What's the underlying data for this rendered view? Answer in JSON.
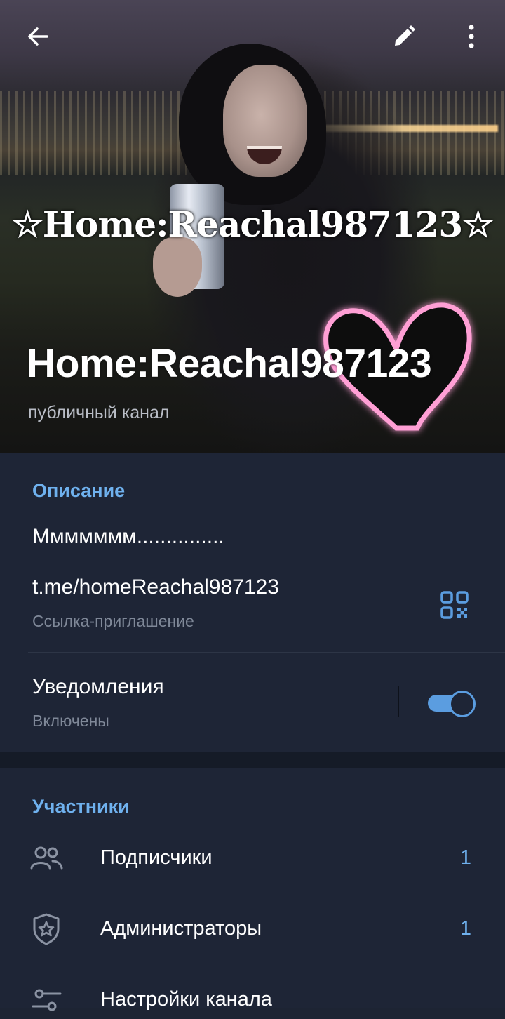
{
  "header": {
    "watermark_text": "☆Home:Reachal987123☆",
    "title": "Home:Reachal987123",
    "subtitle": "публичный канал",
    "icons": {
      "back": "arrow-back-icon",
      "edit": "pencil-icon",
      "menu": "more-vertical-icon"
    }
  },
  "info": {
    "section_title": "Описание",
    "description": "Ммммммм...............",
    "link": "t.me/homeReachal987123",
    "link_caption": "Ссылка-приглашение",
    "qr_icon": "qr-code-icon",
    "notifications_label": "Уведомления",
    "notifications_status": "Включены",
    "notifications_on": true
  },
  "members": {
    "section_title": "Участники",
    "rows": [
      {
        "icon": "users-icon",
        "label": "Подписчики",
        "count": "1"
      },
      {
        "icon": "shield-star-icon",
        "label": "Администраторы",
        "count": "1"
      },
      {
        "icon": "sliders-icon",
        "label": "Настройки канала",
        "count": ""
      }
    ]
  },
  "colors": {
    "accent": "#6fb1ee",
    "background": "#1e2536",
    "toggle": "#5b9de0"
  }
}
